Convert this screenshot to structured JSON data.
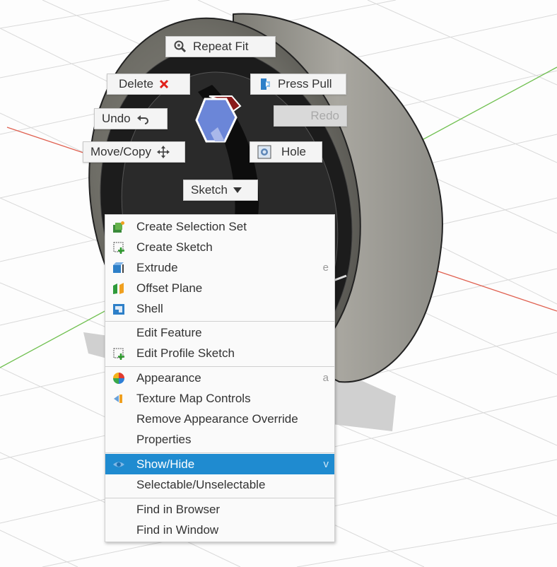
{
  "marking_menu": {
    "repeat_fit": "Repeat Fit",
    "delete": "Delete",
    "press_pull": "Press Pull",
    "undo": "Undo",
    "redo": "Redo",
    "move_copy": "Move/Copy",
    "hole": "Hole",
    "sketch": "Sketch"
  },
  "context_menu": {
    "items": [
      {
        "label": "Create Selection Set",
        "icon": "selection-set-icon"
      },
      {
        "label": "Create Sketch",
        "icon": "create-sketch-icon"
      },
      {
        "label": "Extrude",
        "icon": "extrude-icon",
        "shortcut": "e"
      },
      {
        "label": "Offset Plane",
        "icon": "offset-plane-icon"
      },
      {
        "label": "Shell",
        "icon": "shell-icon"
      },
      {
        "label": "Edit Feature"
      },
      {
        "label": "Edit Profile Sketch",
        "icon": "edit-profile-sketch-icon"
      },
      {
        "label": "Appearance",
        "icon": "appearance-icon",
        "shortcut": "a"
      },
      {
        "label": "Texture Map Controls",
        "icon": "texture-map-icon"
      },
      {
        "label": "Remove Appearance Override"
      },
      {
        "label": "Properties"
      },
      {
        "label": "Show/Hide",
        "icon": "eye-icon",
        "shortcut": "v",
        "highlighted": true
      },
      {
        "label": "Selectable/Unselectable"
      },
      {
        "label": "Find in Browser"
      },
      {
        "label": "Find in Window"
      }
    ]
  },
  "colors": {
    "highlight": "#1f8bd0",
    "delete_x": "#e0201a",
    "x_axis": "#e06050",
    "y_axis": "#70c050"
  }
}
